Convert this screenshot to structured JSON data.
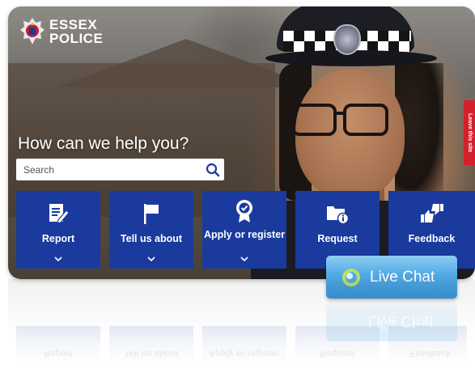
{
  "brand": {
    "line1": "ESSEX",
    "line2": "POLICE"
  },
  "leave_site": "Leave this site",
  "hero": {
    "headline": "How can we help you?"
  },
  "search": {
    "placeholder": "Search"
  },
  "tiles": [
    {
      "label": "Report",
      "icon": "report-edit-icon"
    },
    {
      "label": "Tell us about",
      "icon": "flag-icon"
    },
    {
      "label": "Apply or register",
      "icon": "rosette-badge-icon"
    },
    {
      "label": "Request",
      "icon": "folder-info-icon"
    },
    {
      "label": "Feedback",
      "icon": "thumbs-up-down-icon"
    }
  ],
  "live_chat": {
    "label": "Live Chat"
  },
  "colors": {
    "tile": "#1a3a9e",
    "leave": "#d51f2a",
    "chat": "#4fa9e4"
  }
}
